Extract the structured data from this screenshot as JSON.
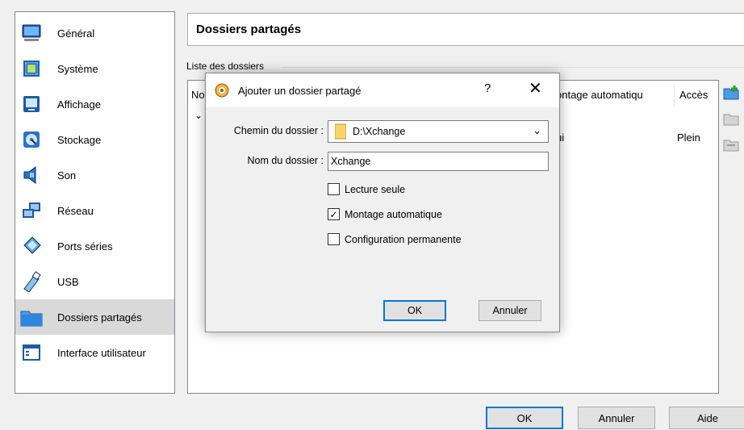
{
  "sidebar": {
    "items": [
      {
        "label": "Général",
        "icon": "monitor-icon"
      },
      {
        "label": "Système",
        "icon": "chip-icon"
      },
      {
        "label": "Affichage",
        "icon": "display-icon"
      },
      {
        "label": "Stockage",
        "icon": "disk-icon"
      },
      {
        "label": "Son",
        "icon": "speaker-icon"
      },
      {
        "label": "Réseau",
        "icon": "network-icon"
      },
      {
        "label": "Ports séries",
        "icon": "serial-port-icon"
      },
      {
        "label": "USB",
        "icon": "usb-icon"
      },
      {
        "label": "Dossiers partagés",
        "icon": "folder-icon",
        "active": true
      },
      {
        "label": "Interface utilisateur",
        "icon": "window-icon"
      }
    ]
  },
  "main": {
    "title": "Dossiers partagés",
    "group_label": "Liste des dossiers",
    "columns": [
      "Nom",
      "Montage automatique",
      "Accès"
    ],
    "header_fragment_left": "No",
    "header_fragment_mount": "ontage automatiqu",
    "header_access": "Accès",
    "row": {
      "mount_fragment": "ui",
      "access": "Plein"
    }
  },
  "buttons": {
    "ok": "OK",
    "cancel": "Annuler",
    "help": "Aide"
  },
  "dialog": {
    "title": "Ajouter un dossier partagé",
    "help_glyph": "?",
    "close_glyph": "✕",
    "path_label": "Chemin du dossier :",
    "path_value": "D:\\Xchange",
    "name_label": "Nom du dossier :",
    "name_value": "Xchange",
    "checkboxes": [
      {
        "label": "Lecture seule",
        "checked": false
      },
      {
        "label": "Montage automatique",
        "checked": true
      },
      {
        "label": "Configuration permanente",
        "checked": false
      }
    ],
    "ok": "OK",
    "cancel": "Annuler"
  },
  "colors": {
    "accent": "#0078d7",
    "selected_bg": "#d9d9d9"
  }
}
